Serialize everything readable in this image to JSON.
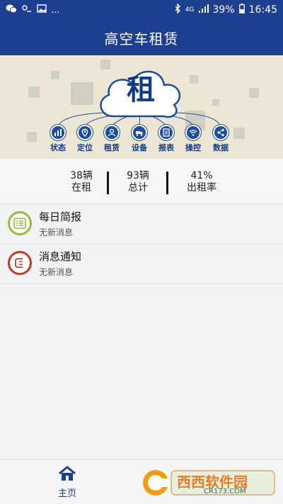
{
  "status_bar": {
    "left_dots": "...",
    "network": "4G",
    "battery": "39%",
    "time": "16:45"
  },
  "header": {
    "title": "高空车租赁"
  },
  "banner": {
    "cloud_glyph": "租",
    "nav": [
      {
        "label": "状态",
        "icon": "bar-chart-icon"
      },
      {
        "label": "定位",
        "icon": "location-pin-icon"
      },
      {
        "label": "租赁",
        "icon": "person-icon"
      },
      {
        "label": "设备",
        "icon": "truck-icon"
      },
      {
        "label": "报表",
        "icon": "document-icon"
      },
      {
        "label": "操控",
        "icon": "wifi-icon"
      },
      {
        "label": "数据",
        "icon": "share-icon"
      }
    ]
  },
  "stats": [
    {
      "value": "38辆",
      "label": "在租"
    },
    {
      "value": "93辆",
      "label": "总计"
    },
    {
      "value": "41%",
      "label": "出租率"
    }
  ],
  "list": [
    {
      "title": "每日简报",
      "subtitle": "无新消息",
      "icon": "daily-report-icon",
      "color": "#8dbf3a"
    },
    {
      "title": "消息通知",
      "subtitle": "无新消息",
      "icon": "notification-icon",
      "color": "#c0392b"
    }
  ],
  "bottom_nav": {
    "home_label": "主页"
  },
  "watermark": {
    "brand": "西西软件园",
    "url": "CR173.COM"
  },
  "colors": {
    "primary": "#1c3f8f",
    "banner_bg": "#ece6d4"
  }
}
